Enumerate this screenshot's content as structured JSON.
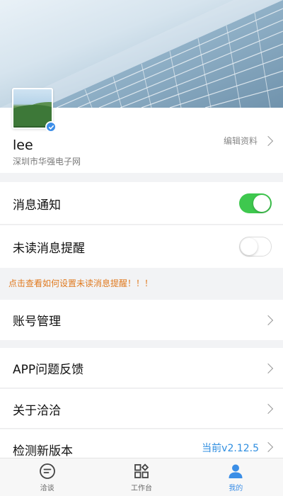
{
  "profile": {
    "username": "lee",
    "company": "深圳市华强电子网",
    "edit_label": "编辑资料"
  },
  "settings": {
    "notification": {
      "label": "消息通知",
      "enabled": true
    },
    "unread_reminder": {
      "label": "未读消息提醒",
      "enabled": false
    },
    "hint": "点击查看如何设置未读消息提醒！！！",
    "account": {
      "label": "账号管理"
    },
    "feedback": {
      "label": "APP问题反馈"
    },
    "about": {
      "label": "关于洽洽"
    },
    "check_update": {
      "label": "检测新版本",
      "version": "当前v2.12.5"
    }
  },
  "tabbar": {
    "tabs": [
      {
        "label": "洽谈",
        "icon": "chat-icon",
        "active": false
      },
      {
        "label": "工作台",
        "icon": "workbench-icon",
        "active": false
      },
      {
        "label": "我的",
        "icon": "person-icon",
        "active": true
      }
    ]
  },
  "colors": {
    "accent": "#3b8ee6",
    "toggle_on": "#3ec84e",
    "hint": "#e07a1f"
  }
}
